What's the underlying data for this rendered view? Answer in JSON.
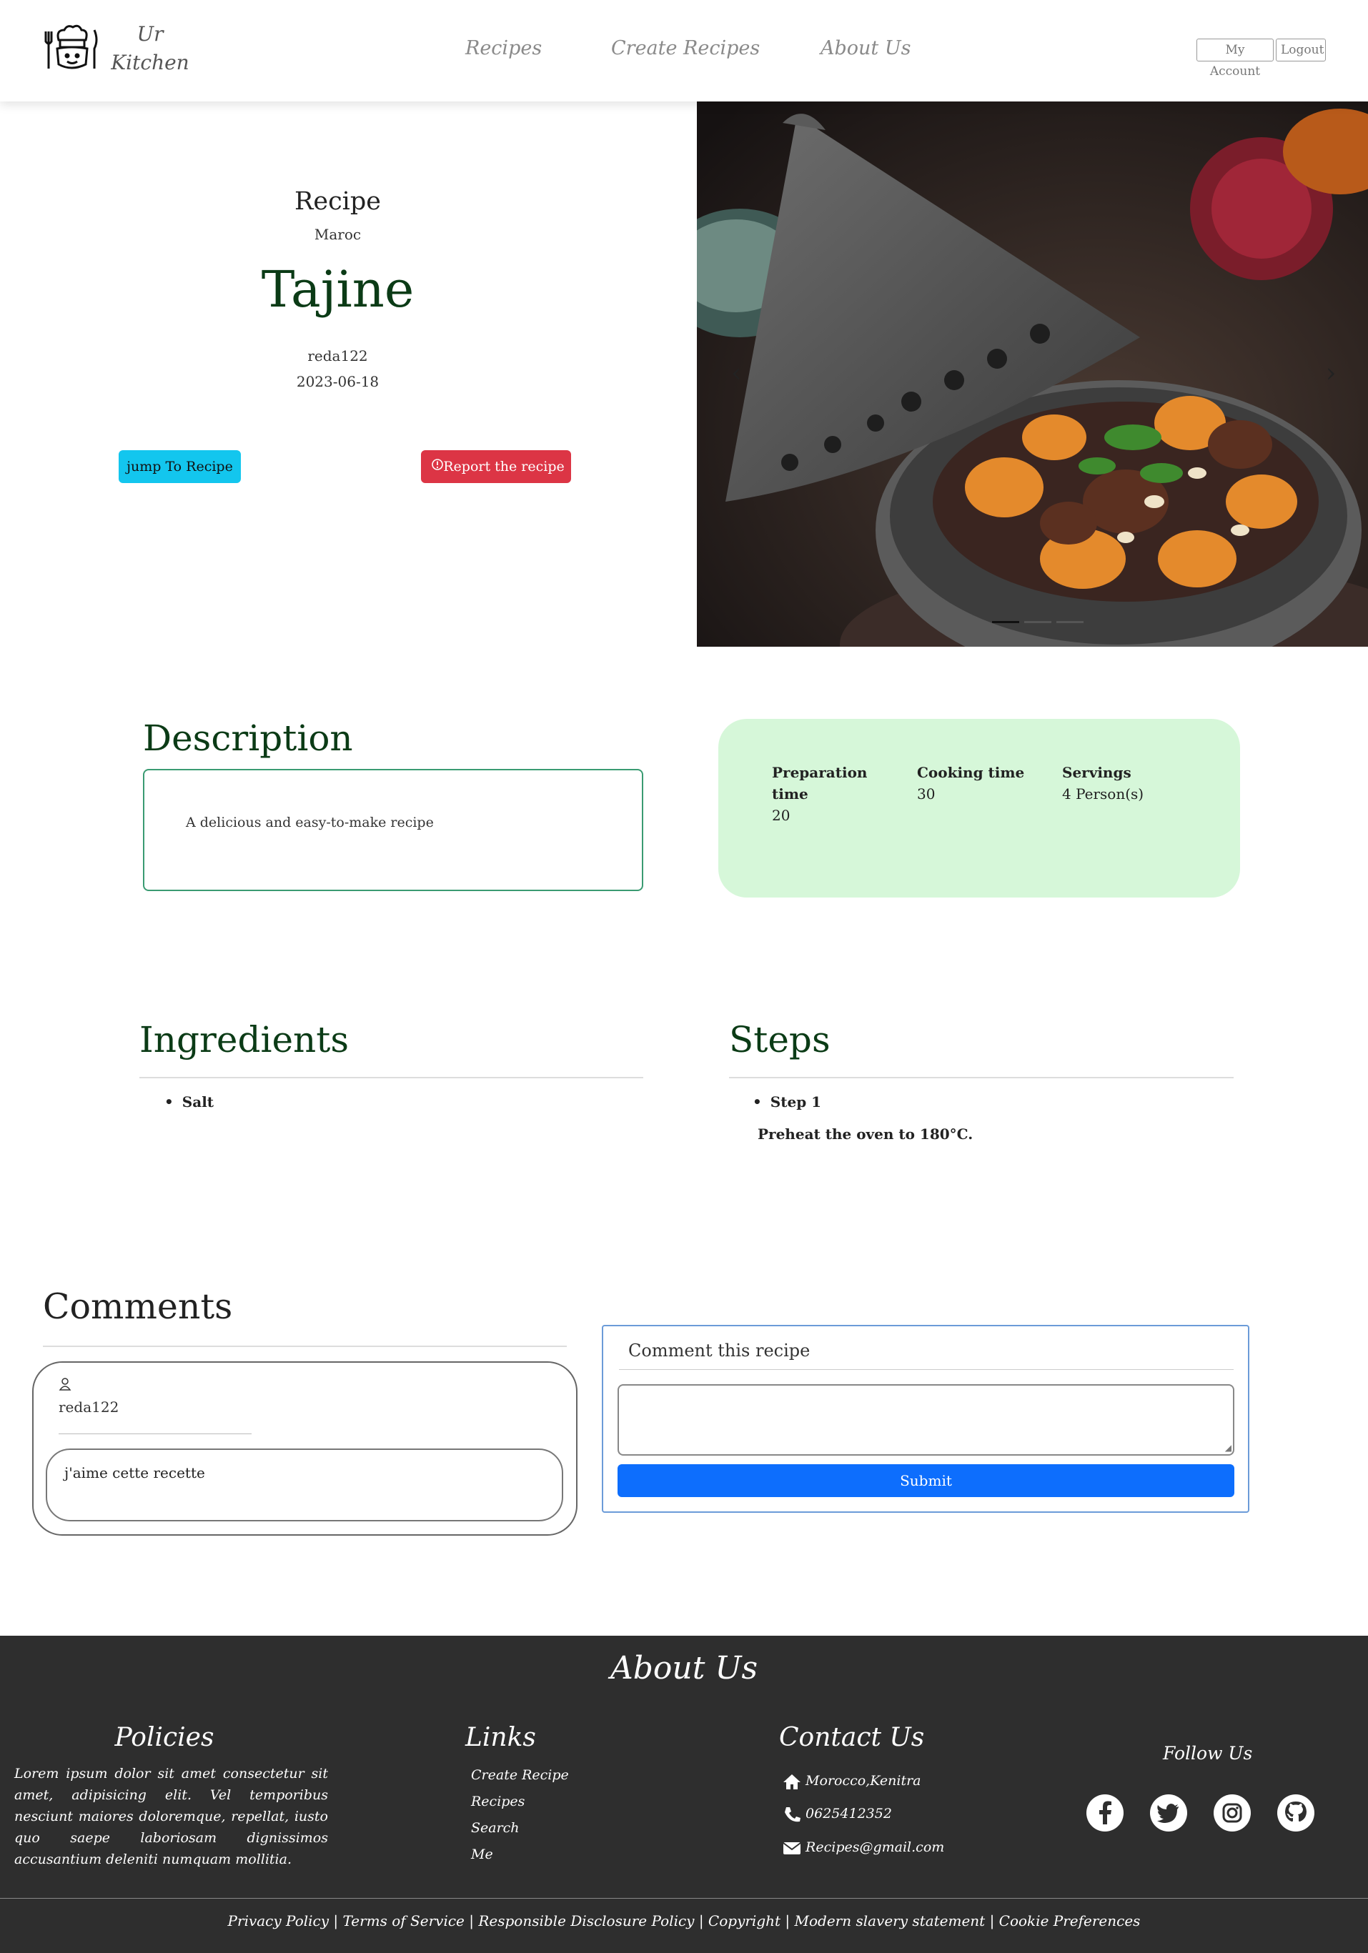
{
  "header": {
    "logo_line1": "Ur",
    "logo_line2": "Kitchen",
    "nav": [
      "Recipes",
      "Create Recipes",
      "About Us"
    ],
    "my_account": "My Account",
    "logout": "Logout"
  },
  "hero": {
    "kicker": "Recipe",
    "origin": "Maroc",
    "title": "Tajine",
    "author": "reda122",
    "date": "2023-06-18",
    "jump_button": "jump To Recipe",
    "report_button": "Report the recipe"
  },
  "description": {
    "heading": "Description",
    "text": "A delicious and easy-to-make recipe"
  },
  "info": {
    "prep_label_1": "Preparation",
    "prep_label_2": "time",
    "prep_value": "20",
    "cook_label": "Cooking time",
    "cook_value": "30",
    "serv_label": "Servings",
    "serv_value": "4 Person(s)"
  },
  "ingredients": {
    "heading": "Ingredients",
    "items": [
      "Salt"
    ]
  },
  "steps": {
    "heading": "Steps",
    "items": [
      {
        "title": "Step 1",
        "text": "Preheat the oven to 180°C."
      }
    ]
  },
  "comments": {
    "heading": "Comments",
    "list": [
      {
        "user": "reda122",
        "text": "j'aime cette recette"
      }
    ],
    "form_title": "Comment this recipe",
    "submit": "Submit"
  },
  "footer": {
    "title": "About Us",
    "policies_title": "Policies",
    "policies_text": "Lorem ipsum dolor sit amet consectetur sit amet, adipisicing elit. Vel temporibus nesciunt maiores doloremque, repellat, iusto quo saepe laboriosam dignissimos accusantium deleniti numquam mollitia.",
    "links_title": "Links",
    "links": [
      "Create Recipe",
      "Recipes",
      "Search",
      "Me"
    ],
    "contact_title": "Contact Us",
    "address": "Morocco,Kenitra",
    "phone": "0625412352",
    "email": "Recipes@gmail.com",
    "follow_title": "Follow Us",
    "social_icons": [
      "facebook-icon",
      "twitter-icon",
      "instagram-icon",
      "github-icon"
    ],
    "legal": "Privacy Policy | Terms of Service | Responsible Disclosure Policy | Copyright | Modern slavery statement | Cookie Preferences"
  },
  "colors": {
    "title_green": "#0b3b16",
    "info_bg": "#d6f7d9",
    "jump_btn": "#13c6ee",
    "report_btn": "#dc3545",
    "submit_btn": "#0d6efd",
    "footer_bg": "#2e2e2e"
  }
}
